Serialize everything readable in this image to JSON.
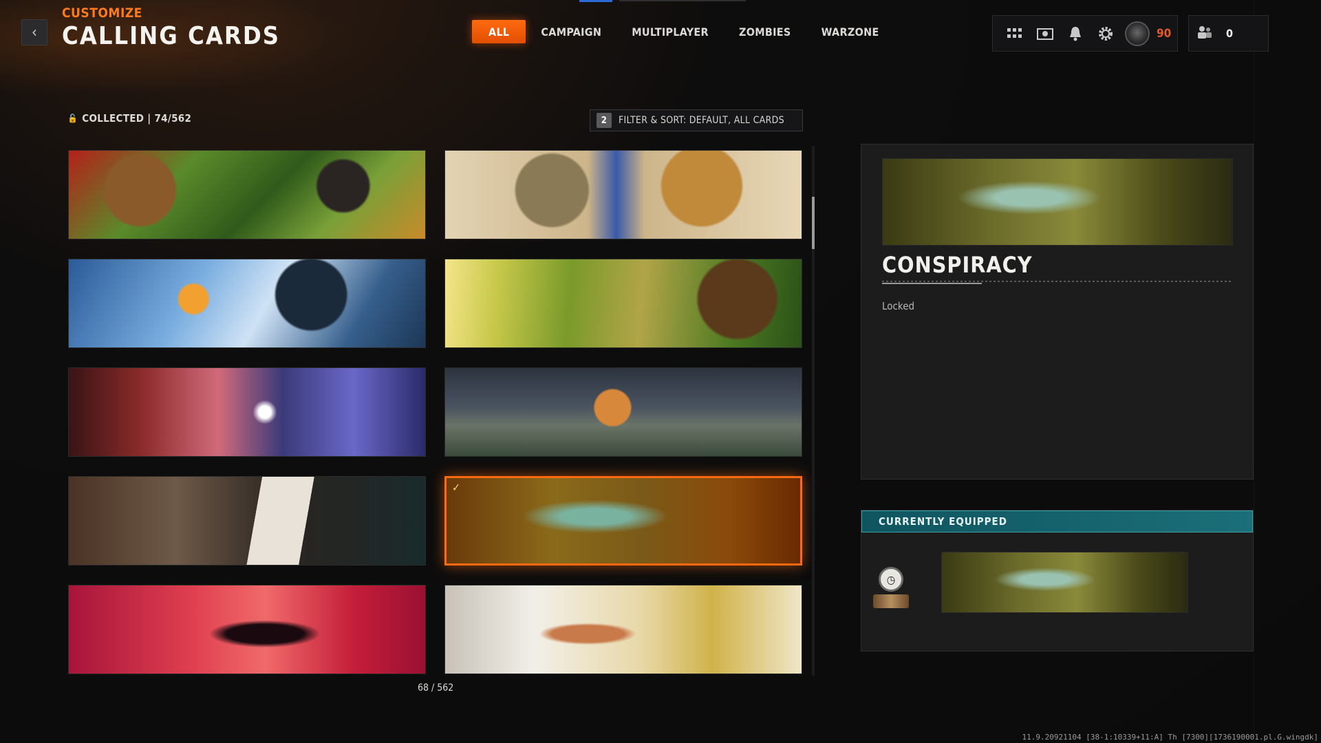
{
  "header": {
    "subtitle": "CUSTOMIZE",
    "title": "CALLING CARDS",
    "back_icon": "chevron-left-icon"
  },
  "tabs": [
    {
      "label": "ALL",
      "active": true
    },
    {
      "label": "CAMPAIGN",
      "active": false
    },
    {
      "label": "MULTIPLAYER",
      "active": false
    },
    {
      "label": "ZOMBIES",
      "active": false
    },
    {
      "label": "WARZONE",
      "active": false
    }
  ],
  "hud": {
    "icons": [
      "grid-menu-icon",
      "store-icon",
      "bell-icon",
      "gear-icon"
    ],
    "rank_value": "90",
    "party_icon": "party-icon",
    "party_count": "0"
  },
  "collection": {
    "collected_text": "COLLECTED | 74/562",
    "filter_key": "2",
    "filter_label": "FILTER & SORT: DEFAULT, ALL CARDS",
    "page_position": "68 / 562"
  },
  "cards": [
    {
      "art": "cat-and-rat-jungle",
      "selected": false
    },
    {
      "art": "crocodile-vs-lion",
      "selected": false
    },
    {
      "art": "snowy-skeleton-gunfight",
      "selected": false
    },
    {
      "art": "monkey-with-rifle",
      "selected": false
    },
    {
      "art": "western-gunslinger-duel",
      "selected": false
    },
    {
      "art": "kid-eating-cereal-with-weapons",
      "selected": false
    },
    {
      "art": "cassette-tape",
      "selected": false
    },
    {
      "art": "skeletal-hand-map",
      "selected": true
    },
    {
      "art": "horseman-on-red",
      "selected": false
    },
    {
      "art": "pinup-on-airplane",
      "selected": false
    }
  ],
  "detail": {
    "name": "CONSPIRACY",
    "status": "Locked"
  },
  "equipped": {
    "header": "CURRENTLY EQUIPPED",
    "emblem": "clock-emblem-icon"
  },
  "footer": {
    "version": "11.9.20921104 [38-1:10339+11:A] Th [7300][1736190001.pl.G.wingdk]"
  },
  "colors": {
    "accent": "#ff6a10",
    "equipped_header": "#1b6f78",
    "rank_text": "#e05a2a"
  }
}
